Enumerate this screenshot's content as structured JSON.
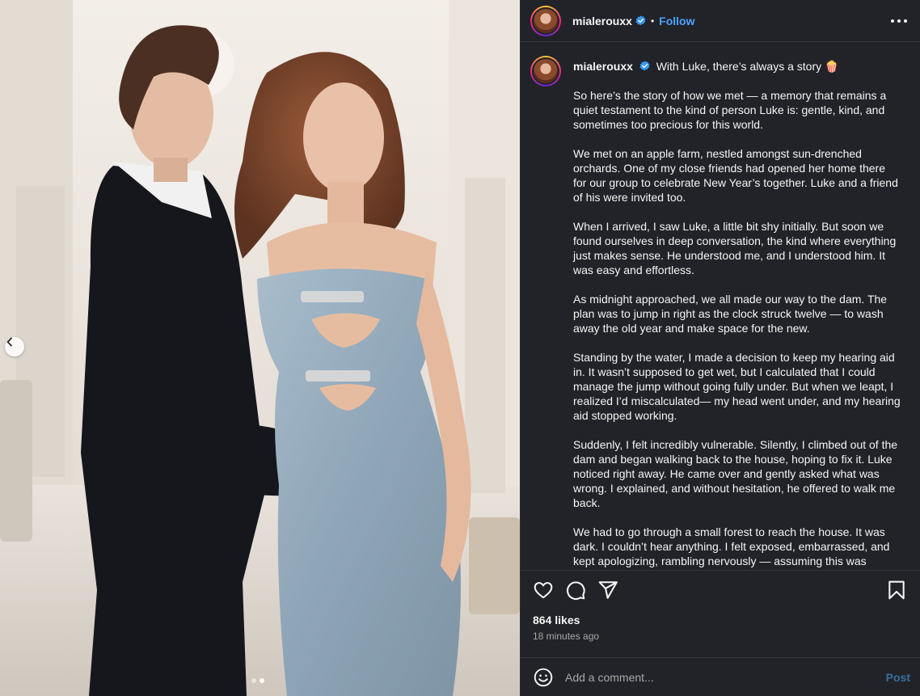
{
  "post": {
    "username": "mialerouxx",
    "follow_label": "Follow",
    "separator": "•",
    "caption_headline": "With Luke, there’s always a story 🍿",
    "caption_paragraphs": [
      "So here’s the story of how we met — a memory that remains a quiet testament to the kind of person Luke is: gentle, kind, and sometimes too precious for this world.",
      "We met on an apple farm, nestled amongst sun-drenched orchards. One of my close friends had opened her home there for our group to celebrate New Year’s together. Luke and a friend of his were invited too.",
      "When I arrived, I saw Luke, a little bit shy initially. But soon we found ourselves in deep conversation, the kind where everything just makes sense. He understood me, and I understood him. It was easy and effortless.",
      "As midnight approached, we all made our way to the dam. The plan was to jump in right as the clock struck twelve — to wash away the old year and make space for the new.",
      "Standing by the water, I made a decision to keep my hearing aid in. It wasn’t supposed to get wet, but I calculated that I could manage the jump without going fully under. But when we leapt, I realized I’d miscalculated— my head went under, and my hearing aid stopped working.",
      "Suddenly, I felt incredibly vulnerable. Silently, I climbed out of the dam and began walking back to the house, hoping to fix it. Luke noticed right away. He came over and gently asked what was wrong. I explained, and without hesitation, he offered to walk me back.",
      "We had to go through a small forest to reach the house. It was dark. I couldn’t hear anything. I felt exposed, embarrassed, and kept apologizing, rambling nervously — assuming this was"
    ],
    "likes": "864 likes",
    "timestamp": "18 minutes ago"
  },
  "comment": {
    "placeholder": "Add a comment...",
    "post_label": "Post"
  },
  "carousel": {
    "slide_count": 2,
    "active_index": 1
  },
  "icons": {
    "header": [
      "verified-badge-icon",
      "more-options-icon"
    ],
    "actions": [
      "heart-icon",
      "comment-icon",
      "share-icon",
      "bookmark-icon"
    ],
    "composer": [
      "emoji-icon"
    ],
    "media": [
      "chevron-left-icon"
    ]
  },
  "colors": {
    "panel_bg": "#212328",
    "link_blue": "#4da3ff",
    "verified_blue": "#3897f0",
    "muted_text": "#a8a8a8",
    "post_button": "#3c6e9e"
  }
}
